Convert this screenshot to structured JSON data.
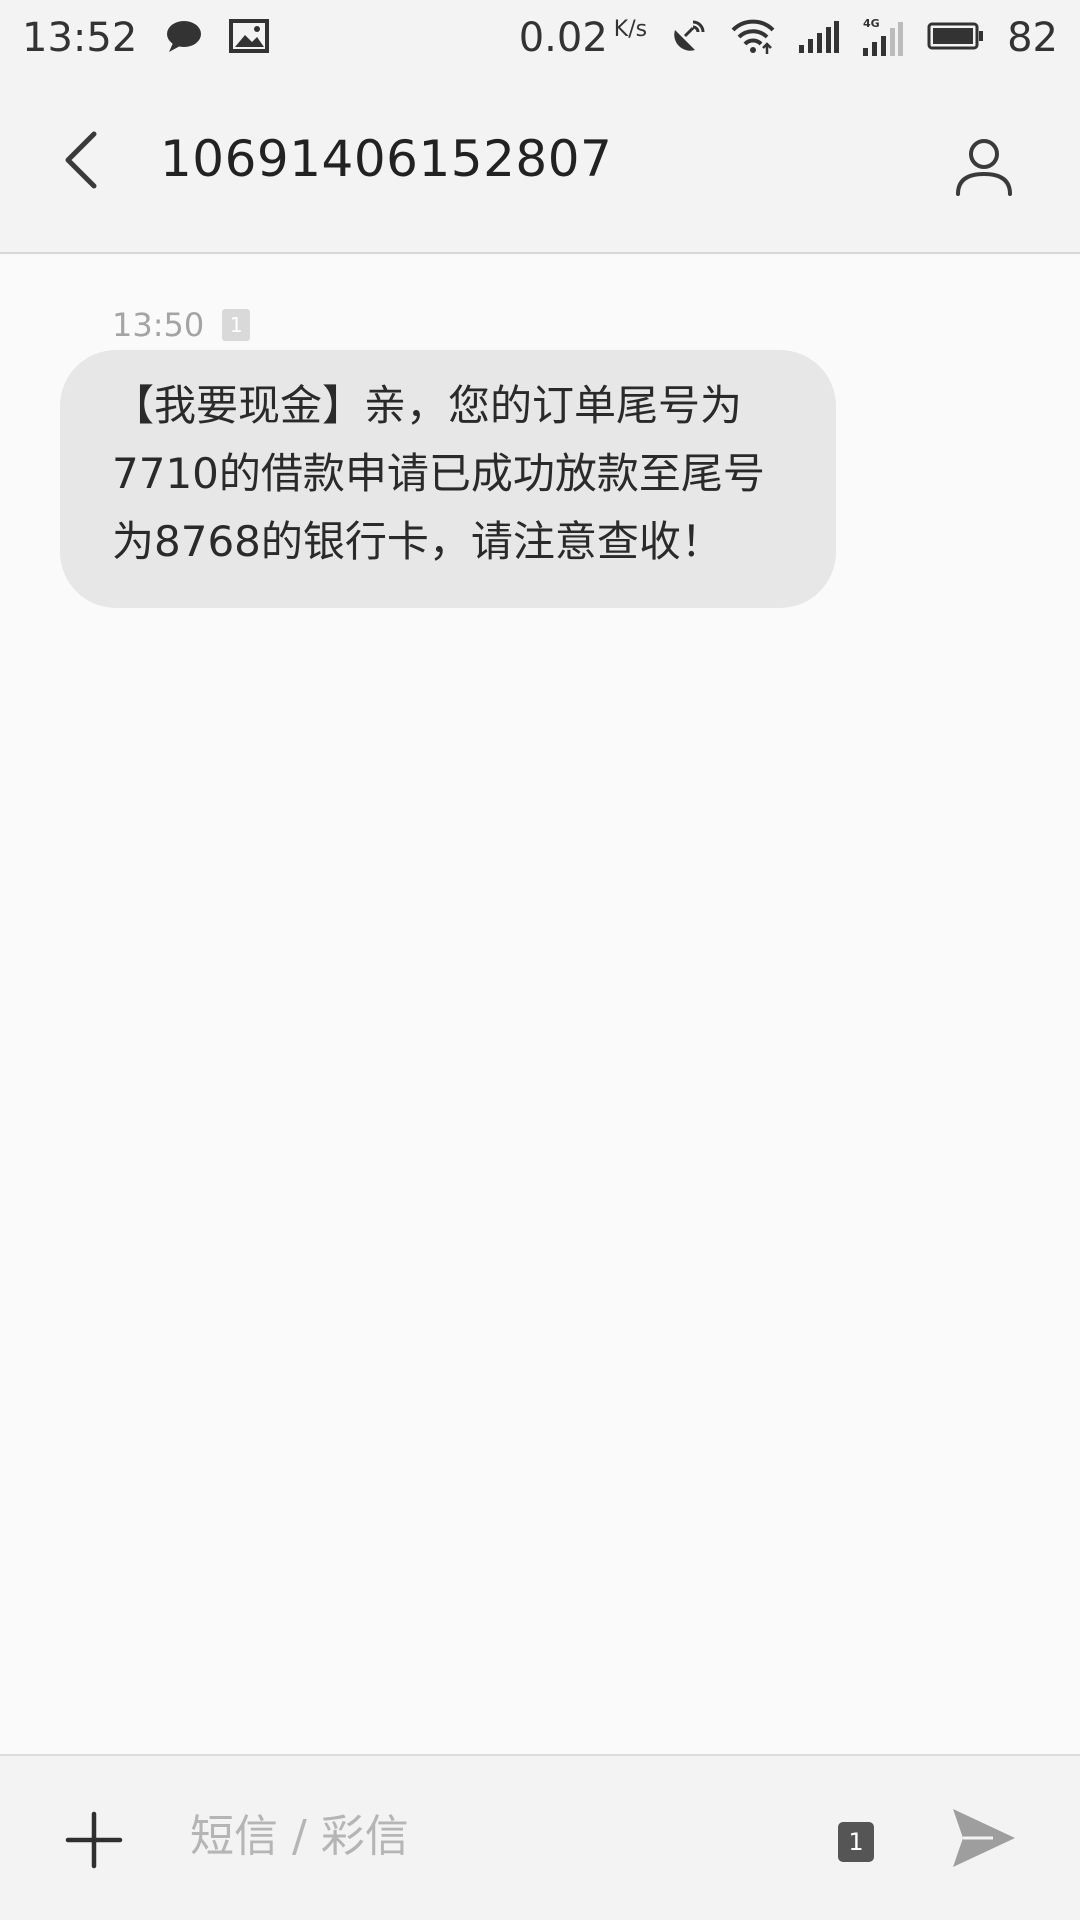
{
  "status_bar": {
    "time": "13:52",
    "notification_icons": [
      "chat-bubble-icon",
      "image-icon"
    ],
    "network_speed": "0.02",
    "network_speed_unit": "K/s",
    "system_icons": [
      "satellite-dish-icon",
      "wifi-icon",
      "signal-bars-icon",
      "signal-4g-icon",
      "battery-icon"
    ],
    "battery_percent": "82"
  },
  "header": {
    "title": "10691406152807"
  },
  "conversation": {
    "messages": [
      {
        "time": "13:50",
        "sim": "1",
        "text": "【我要现金】亲，您的订单尾号为7710的借款申请已成功放款至尾号为8768的银行卡，请注意查收！"
      }
    ]
  },
  "composer": {
    "placeholder": "短信 / 彩信",
    "sim": "1"
  },
  "colors": {
    "background": "#fafafa",
    "bars": "#f3f3f3",
    "bubble": "#e7e7e7",
    "icon": "#3a3a3a",
    "send_icon": "#9e9e9e"
  }
}
